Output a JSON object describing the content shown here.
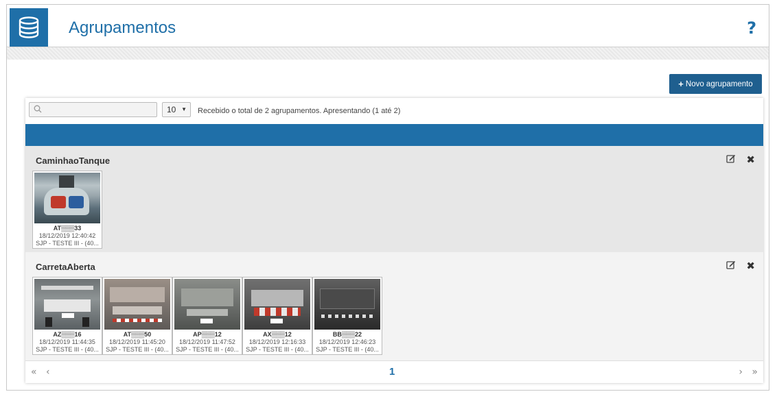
{
  "header": {
    "title": "Agrupamentos",
    "help": "?"
  },
  "toolbar": {
    "new_button": "Novo agrupamento",
    "search_placeholder": "",
    "page_size": "10",
    "info": "Recebido o total de 2 agrupamentos. Apresentando (1 até 2)"
  },
  "groups": [
    {
      "name": "CaminhaoTanque",
      "items": [
        {
          "plate": "AT▒▒▒33",
          "date": "18/12/2019 12:40:42",
          "loc": "SJP - TESTE III - (40..."
        }
      ]
    },
    {
      "name": "CarretaAberta",
      "items": [
        {
          "plate": "AZ▒▒▒16",
          "date": "18/12/2019 11:44:35",
          "loc": "SJP - TESTE III - (40..."
        },
        {
          "plate": "AT▒▒▒50",
          "date": "18/12/2019 11:45:20",
          "loc": "SJP - TESTE III - (40..."
        },
        {
          "plate": "AP▒▒▒12",
          "date": "18/12/2019 11:47:52",
          "loc": "SJP - TESTE III - (40..."
        },
        {
          "plate": "AX▒▒▒12",
          "date": "18/12/2019 12:16:33",
          "loc": "SJP - TESTE III - (40..."
        },
        {
          "plate": "BB▒▒▒22",
          "date": "18/12/2019 12:46:23",
          "loc": "SJP - TESTE III - (40..."
        }
      ]
    }
  ],
  "pagination": {
    "first": "«",
    "prev": "‹",
    "current": "1",
    "next": "›",
    "last": "»"
  },
  "colors": {
    "accent": "#1f6fa8",
    "button": "#1f5f8f"
  }
}
